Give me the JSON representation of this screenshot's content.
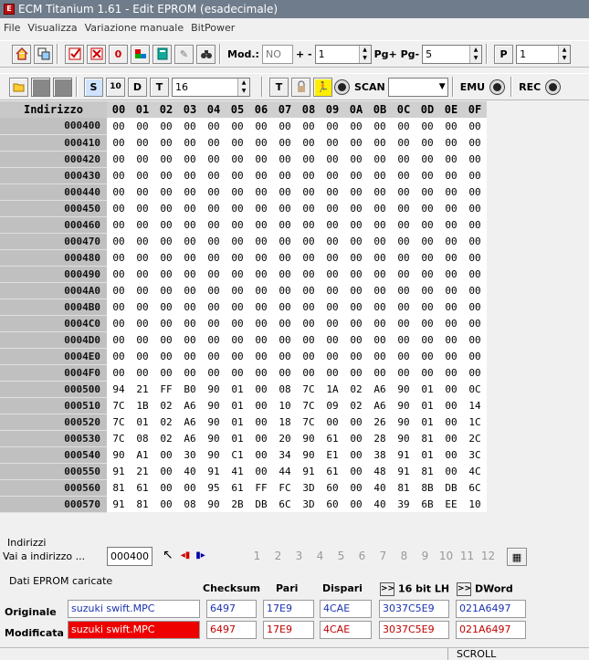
{
  "window": {
    "title": "ECM Titanium 1.61 - Edit EPROM (esadecimale)"
  },
  "menu": [
    "File",
    "Visualizza",
    "Variazione manuale",
    "BitPower"
  ],
  "toolbar1": {
    "mod_label": "Mod.:",
    "mod_value": "NO",
    "plusminus_label": "+ -",
    "plusminus_value": "1",
    "pg_label": "Pg+ Pg-",
    "pg_value": "5",
    "p_value": "1"
  },
  "toolbar2": {
    "s_icon": "S",
    "ten_icon": "10",
    "d_icon": "D",
    "t_icon": "T",
    "width_value": "16",
    "scan_label": "SCAN",
    "emu_label": "EMU",
    "rec_label": "REC"
  },
  "grid": {
    "address_header": "Indirizzo",
    "columns": [
      "00",
      "01",
      "02",
      "03",
      "04",
      "05",
      "06",
      "07",
      "08",
      "09",
      "0A",
      "0B",
      "0C",
      "0D",
      "0E",
      "0F"
    ],
    "rows": [
      {
        "addr": "000400",
        "cells": [
          "00",
          "00",
          "00",
          "00",
          "00",
          "00",
          "00",
          "00",
          "00",
          "00",
          "00",
          "00",
          "00",
          "00",
          "00",
          "00"
        ]
      },
      {
        "addr": "000410",
        "cells": [
          "00",
          "00",
          "00",
          "00",
          "00",
          "00",
          "00",
          "00",
          "00",
          "00",
          "00",
          "00",
          "00",
          "00",
          "00",
          "00"
        ]
      },
      {
        "addr": "000420",
        "cells": [
          "00",
          "00",
          "00",
          "00",
          "00",
          "00",
          "00",
          "00",
          "00",
          "00",
          "00",
          "00",
          "00",
          "00",
          "00",
          "00"
        ]
      },
      {
        "addr": "000430",
        "cells": [
          "00",
          "00",
          "00",
          "00",
          "00",
          "00",
          "00",
          "00",
          "00",
          "00",
          "00",
          "00",
          "00",
          "00",
          "00",
          "00"
        ]
      },
      {
        "addr": "000440",
        "cells": [
          "00",
          "00",
          "00",
          "00",
          "00",
          "00",
          "00",
          "00",
          "00",
          "00",
          "00",
          "00",
          "00",
          "00",
          "00",
          "00"
        ]
      },
      {
        "addr": "000450",
        "cells": [
          "00",
          "00",
          "00",
          "00",
          "00",
          "00",
          "00",
          "00",
          "00",
          "00",
          "00",
          "00",
          "00",
          "00",
          "00",
          "00"
        ]
      },
      {
        "addr": "000460",
        "cells": [
          "00",
          "00",
          "00",
          "00",
          "00",
          "00",
          "00",
          "00",
          "00",
          "00",
          "00",
          "00",
          "00",
          "00",
          "00",
          "00"
        ]
      },
      {
        "addr": "000470",
        "cells": [
          "00",
          "00",
          "00",
          "00",
          "00",
          "00",
          "00",
          "00",
          "00",
          "00",
          "00",
          "00",
          "00",
          "00",
          "00",
          "00"
        ]
      },
      {
        "addr": "000480",
        "cells": [
          "00",
          "00",
          "00",
          "00",
          "00",
          "00",
          "00",
          "00",
          "00",
          "00",
          "00",
          "00",
          "00",
          "00",
          "00",
          "00"
        ]
      },
      {
        "addr": "000490",
        "cells": [
          "00",
          "00",
          "00",
          "00",
          "00",
          "00",
          "00",
          "00",
          "00",
          "00",
          "00",
          "00",
          "00",
          "00",
          "00",
          "00"
        ]
      },
      {
        "addr": "0004A0",
        "cells": [
          "00",
          "00",
          "00",
          "00",
          "00",
          "00",
          "00",
          "00",
          "00",
          "00",
          "00",
          "00",
          "00",
          "00",
          "00",
          "00"
        ]
      },
      {
        "addr": "0004B0",
        "cells": [
          "00",
          "00",
          "00",
          "00",
          "00",
          "00",
          "00",
          "00",
          "00",
          "00",
          "00",
          "00",
          "00",
          "00",
          "00",
          "00"
        ]
      },
      {
        "addr": "0004C0",
        "cells": [
          "00",
          "00",
          "00",
          "00",
          "00",
          "00",
          "00",
          "00",
          "00",
          "00",
          "00",
          "00",
          "00",
          "00",
          "00",
          "00"
        ]
      },
      {
        "addr": "0004D0",
        "cells": [
          "00",
          "00",
          "00",
          "00",
          "00",
          "00",
          "00",
          "00",
          "00",
          "00",
          "00",
          "00",
          "00",
          "00",
          "00",
          "00"
        ]
      },
      {
        "addr": "0004E0",
        "cells": [
          "00",
          "00",
          "00",
          "00",
          "00",
          "00",
          "00",
          "00",
          "00",
          "00",
          "00",
          "00",
          "00",
          "00",
          "00",
          "00"
        ]
      },
      {
        "addr": "0004F0",
        "cells": [
          "00",
          "00",
          "00",
          "00",
          "00",
          "00",
          "00",
          "00",
          "00",
          "00",
          "00",
          "00",
          "00",
          "00",
          "00",
          "00"
        ]
      },
      {
        "addr": "000500",
        "cells": [
          "94",
          "21",
          "FF",
          "B0",
          "90",
          "01",
          "00",
          "08",
          "7C",
          "1A",
          "02",
          "A6",
          "90",
          "01",
          "00",
          "0C"
        ]
      },
      {
        "addr": "000510",
        "cells": [
          "7C",
          "1B",
          "02",
          "A6",
          "90",
          "01",
          "00",
          "10",
          "7C",
          "09",
          "02",
          "A6",
          "90",
          "01",
          "00",
          "14"
        ]
      },
      {
        "addr": "000520",
        "cells": [
          "7C",
          "01",
          "02",
          "A6",
          "90",
          "01",
          "00",
          "18",
          "7C",
          "00",
          "00",
          "26",
          "90",
          "01",
          "00",
          "1C"
        ]
      },
      {
        "addr": "000530",
        "cells": [
          "7C",
          "08",
          "02",
          "A6",
          "90",
          "01",
          "00",
          "20",
          "90",
          "61",
          "00",
          "28",
          "90",
          "81",
          "00",
          "2C"
        ]
      },
      {
        "addr": "000540",
        "cells": [
          "90",
          "A1",
          "00",
          "30",
          "90",
          "C1",
          "00",
          "34",
          "90",
          "E1",
          "00",
          "38",
          "91",
          "01",
          "00",
          "3C"
        ]
      },
      {
        "addr": "000550",
        "cells": [
          "91",
          "21",
          "00",
          "40",
          "91",
          "41",
          "00",
          "44",
          "91",
          "61",
          "00",
          "48",
          "91",
          "81",
          "00",
          "4C"
        ]
      },
      {
        "addr": "000560",
        "cells": [
          "81",
          "61",
          "00",
          "00",
          "95",
          "61",
          "FF",
          "FC",
          "3D",
          "60",
          "00",
          "40",
          "81",
          "8B",
          "DB",
          "6C"
        ]
      },
      {
        "addr": "000570",
        "cells": [
          "91",
          "81",
          "00",
          "08",
          "90",
          "2B",
          "DB",
          "6C",
          "3D",
          "60",
          "00",
          "40",
          "39",
          "6B",
          "EE",
          "10"
        ]
      }
    ]
  },
  "indirizzi": {
    "title": "Indirizzi",
    "goto_label": "Vai a indirizzo ...",
    "goto_value": "000400",
    "pages": [
      "1",
      "2",
      "3",
      "4",
      "5",
      "6",
      "7",
      "8",
      "9",
      "10",
      "11",
      "12"
    ]
  },
  "dati": {
    "title": "Dati EPROM caricate",
    "headers": {
      "checksum": "Checksum",
      "pari": "Pari",
      "dispari": "Dispari",
      "bit16": "16 bit LH",
      "dword": "DWord"
    },
    "original": {
      "label": "Originale",
      "file": "suzuki swift.MPC",
      "checksum": "6497",
      "pari": "17E9",
      "dispari": "4CAE",
      "bit16": "3037C5E9",
      "dword": "021A6497"
    },
    "modified": {
      "label": "Modificata",
      "file": "suzuki swift.MPC",
      "checksum": "6497",
      "pari": "17E9",
      "dispari": "4CAE",
      "bit16": "3037C5E9",
      "dword": "021A6497"
    }
  },
  "status": {
    "scroll": "SCROLL"
  },
  "colors": {
    "highlight_red": "#ee0000",
    "text_blue": "#1b33b0",
    "text_red": "#c00000",
    "title_bar": "#6f7c8b"
  }
}
